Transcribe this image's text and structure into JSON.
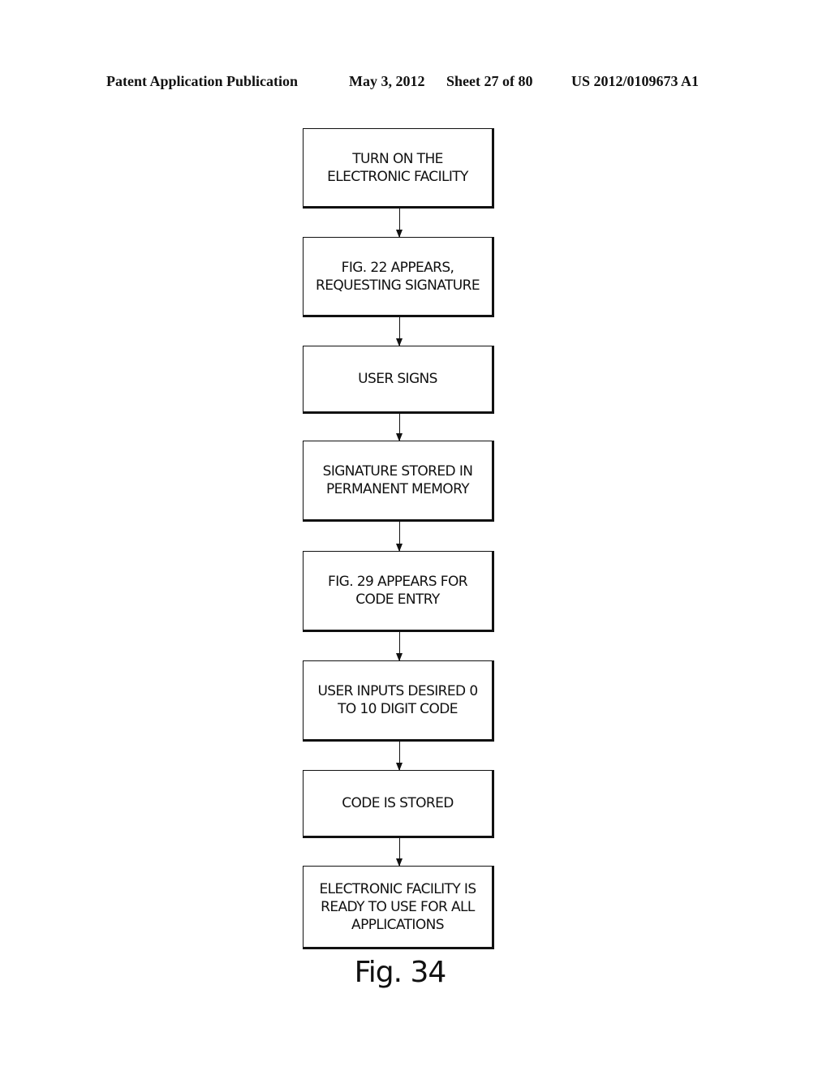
{
  "header": {
    "left": "Patent Application Publication",
    "date": "May 3, 2012",
    "sheet": "Sheet 27 of 80",
    "pub_number": "US 2012/0109673 A1"
  },
  "flowchart": {
    "steps": [
      "TURN ON THE\nELECTRONIC FACILITY",
      "FIG. 22 APPEARS,\nREQUESTING SIGNATURE",
      "USER SIGNS",
      "SIGNATURE STORED IN\nPERMANENT MEMORY",
      "FIG. 29 APPEARS FOR\nCODE ENTRY",
      "USER INPUTS DESIRED 0\nTO 10 DIGIT CODE",
      "CODE IS STORED",
      "ELECTRONIC FACILITY IS\nREADY TO USE FOR ALL\nAPPLICATIONS"
    ]
  },
  "figure_label": "Fig. 34"
}
